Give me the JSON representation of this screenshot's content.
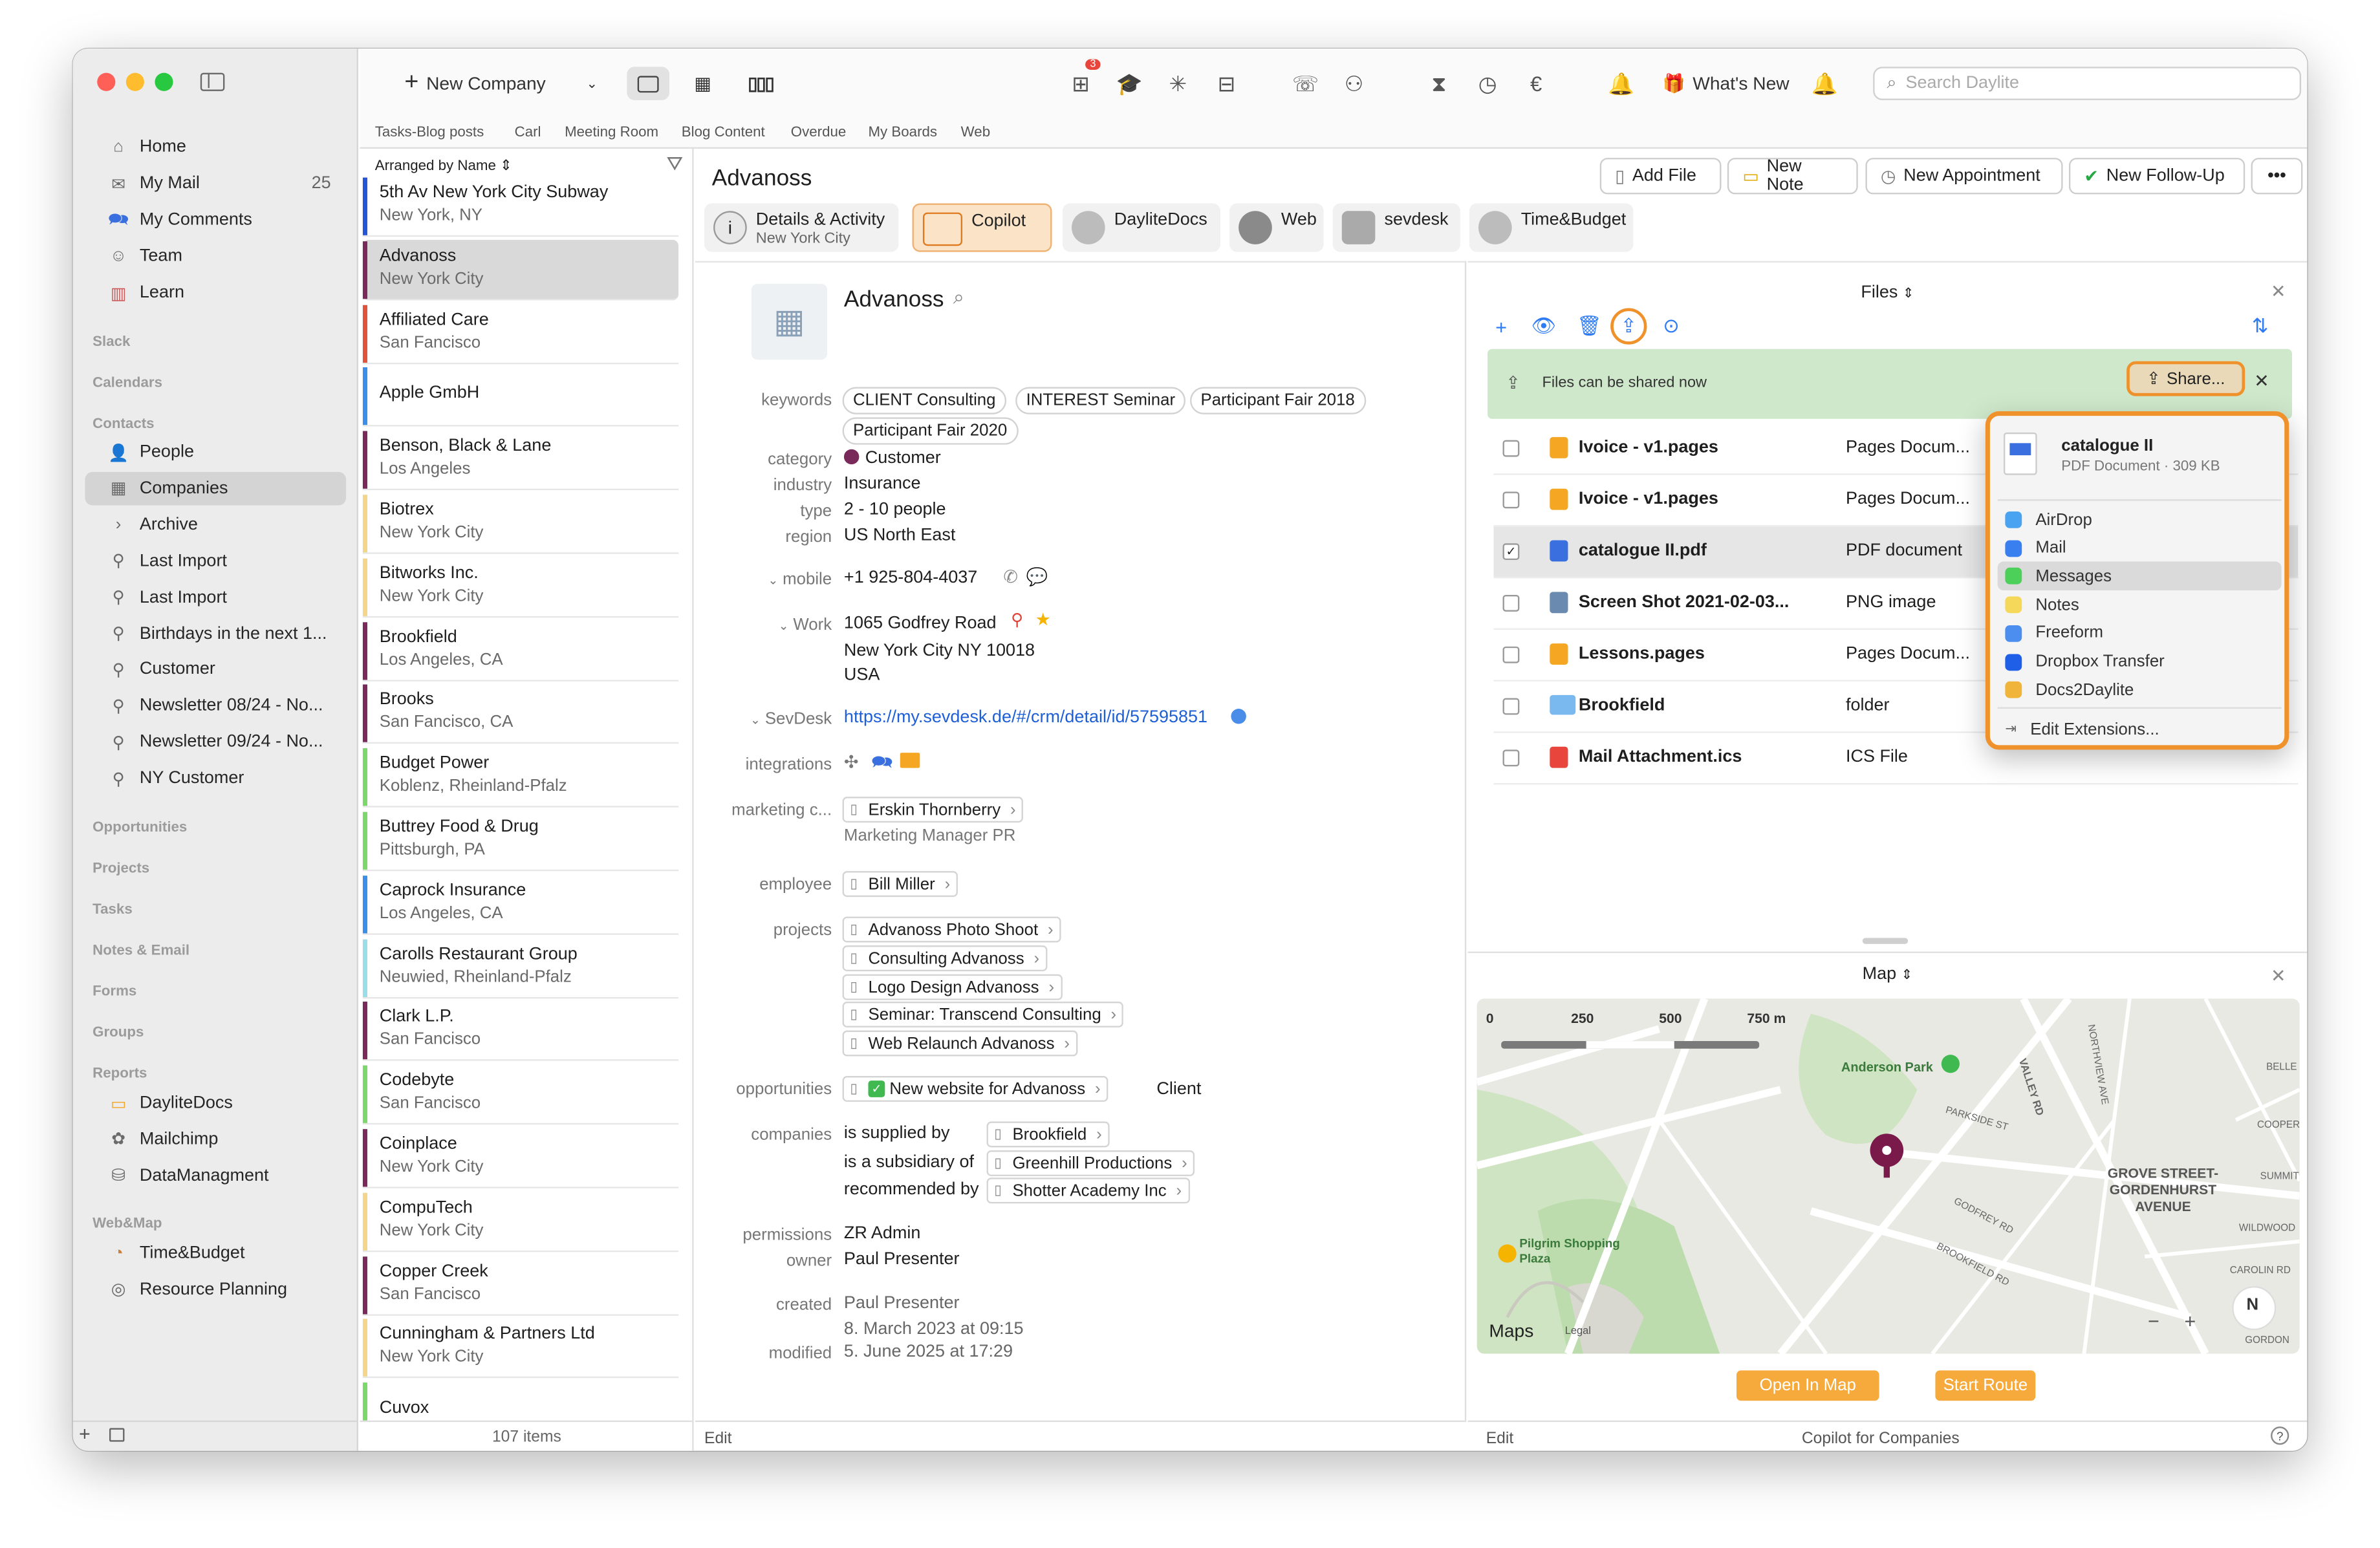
{
  "sidebar": {
    "nav": [
      {
        "label": "Home",
        "icon": "house-icon"
      },
      {
        "label": "My Mail",
        "icon": "envelope-icon",
        "count": "25"
      },
      {
        "label": "My Comments",
        "icon": "comments-icon"
      },
      {
        "label": "Team",
        "icon": "team-icon"
      },
      {
        "label": "Learn",
        "icon": "books-icon"
      }
    ],
    "sections": [
      "Slack",
      "Calendars",
      "Contacts",
      "Opportunities",
      "Projects",
      "Tasks",
      "Notes & Email",
      "Forms",
      "Groups",
      "Reports",
      "Web&Map"
    ],
    "contacts": [
      {
        "label": "People",
        "icon": "person-icon"
      },
      {
        "label": "Companies",
        "icon": "building-icon",
        "selected": true
      },
      {
        "label": "Archive",
        "icon": "chevron-right-icon"
      },
      {
        "label": "Last Import",
        "icon": "smart-list-icon"
      },
      {
        "label": "Last Import",
        "icon": "smart-list-icon"
      },
      {
        "label": "Birthdays in the next 1...",
        "icon": "smart-list-icon"
      },
      {
        "label": "Customer",
        "icon": "smart-list-icon"
      },
      {
        "label": "Newsletter 08/24 - No...",
        "icon": "smart-list-icon"
      },
      {
        "label": "Newsletter 09/24 - No...",
        "icon": "smart-list-icon"
      },
      {
        "label": "NY Customer",
        "icon": "smart-list-icon"
      }
    ],
    "reports": [
      {
        "label": "DayliteDocs",
        "icon": "folder-icon"
      },
      {
        "label": "Mailchimp",
        "icon": "mailchimp-icon"
      },
      {
        "label": "DataManagment",
        "icon": "data-icon"
      }
    ],
    "webmap": [
      {
        "label": "Time&Budget",
        "icon": "timebudget-icon"
      },
      {
        "label": "Resource Planning",
        "icon": "resource-icon"
      }
    ]
  },
  "toolbar": {
    "new_company": "New Company",
    "notification_badge": "3",
    "whats_new": "What's New",
    "search_placeholder": "Search Daylite"
  },
  "favorites": [
    "Tasks-Blog posts",
    "Carl",
    "Meeting Room",
    "Blog Content",
    "Overdue",
    "My Boards",
    "Web"
  ],
  "list": {
    "arranged_by": "Arranged by Name",
    "count": "107 items",
    "companies": [
      {
        "name": "5th Av New York City Subway",
        "city": "New York, NY",
        "color": "#2455d6"
      },
      {
        "name": "Advanoss",
        "city": "New York City",
        "color": "#7a2a5a",
        "selected": true
      },
      {
        "name": "Affiliated Care",
        "city": "San Fancisco",
        "color": "#e0533c"
      },
      {
        "name": "Apple GmbH",
        "city": "",
        "color": "#3d8ee6"
      },
      {
        "name": "Benson, Black & Lane",
        "city": "Los Angeles",
        "color": "#7a2a5a"
      },
      {
        "name": "Biotrex",
        "city": "New York City",
        "color": "#f3d68a"
      },
      {
        "name": "Bitworks Inc.",
        "city": "New York City",
        "color": "#f3d68a"
      },
      {
        "name": "Brookfield",
        "city": "Los Angeles, CA",
        "color": "#7a2a5a"
      },
      {
        "name": "Brooks",
        "city": "San Fancisco, CA",
        "color": "#7a2a5a"
      },
      {
        "name": "Budget Power",
        "city": "Koblenz, Rheinland-Pfalz",
        "color": "#7bd86a"
      },
      {
        "name": "Buttrey Food & Drug",
        "city": "Pittsburgh, PA",
        "color": "#7bd86a"
      },
      {
        "name": "Caprock Insurance",
        "city": "Los Angeles, CA",
        "color": "#3d8ee6"
      },
      {
        "name": "Carolls Restaurant Group",
        "city": "Neuwied, Rheinland-Pfalz",
        "color": "#9bdde8"
      },
      {
        "name": "Clark L.P.",
        "city": "San Fancisco",
        "color": "#7a2a5a"
      },
      {
        "name": "Codebyte",
        "city": "San Fancisco",
        "color": "#7bd86a"
      },
      {
        "name": "Coinplace",
        "city": "New York City",
        "color": "#7a2a5a"
      },
      {
        "name": "CompuTech",
        "city": "New York City",
        "color": "#f3d68a"
      },
      {
        "name": "Copper Creek",
        "city": "San Fancisco",
        "color": "#7a2a5a"
      },
      {
        "name": "Cunningham & Partners Ltd",
        "city": "New York City",
        "color": "#f3d68a"
      },
      {
        "name": "Cuvox",
        "city": "",
        "color": "#7bd86a"
      }
    ]
  },
  "header": {
    "title": "Advanoss",
    "actions": [
      "Add File",
      "New Note",
      "New Appointment",
      "New Follow-Up"
    ],
    "tabs": [
      {
        "label": "Details & Activity",
        "sub": "New York City"
      },
      {
        "label": "Copilot",
        "sub": ""
      },
      {
        "label": "DayliteDocs",
        "sub": ""
      },
      {
        "label": "Web",
        "sub": ""
      },
      {
        "label": "sevdesk",
        "sub": ""
      },
      {
        "label": "Time&Budget",
        "sub": ""
      }
    ]
  },
  "detail": {
    "name": "Advanoss",
    "labels": {
      "keywords": "keywords",
      "category": "category",
      "industry": "industry",
      "type": "type",
      "region": "region",
      "mobile": "mobile",
      "work": "Work",
      "sevdesk": "SevDesk",
      "integrations": "integrations",
      "marketing": "marketing c...",
      "employee": "employee",
      "projects": "projects",
      "opportunities": "opportunities",
      "companies": "companies",
      "permissions": "permissions",
      "owner": "owner",
      "created": "created",
      "modified": "modified"
    },
    "keywords": [
      "CLIENT Consulting",
      "INTEREST Seminar",
      "Participant Fair 2018",
      "Participant Fair 2020"
    ],
    "category": "Customer",
    "category_color": "#7a2a5a",
    "industry": "Insurance",
    "type": "2 - 10 people",
    "region": "US North East",
    "mobile": "+1 925-804-4037",
    "address": [
      "1065 Godfrey Road",
      "New York City NY 10018",
      "USA"
    ],
    "sevdesk_url": "https://my.sevdesk.de/#/crm/detail/id/57595851",
    "marketing_contact": "Erskin Thornberry",
    "marketing_role": "Marketing Manager PR",
    "employee": "Bill Miller",
    "projects": [
      "Advanoss Photo Shoot",
      "Consulting Advanoss",
      "Logo Design Advanoss",
      "Seminar: Transcend Consulting",
      "Web Relaunch Advanoss"
    ],
    "opportunity": "New website for Advanoss",
    "opportunity_role": "Client",
    "relations": [
      {
        "rel": "is supplied by",
        "company": "Brookfield"
      },
      {
        "rel": "is a subsidiary of",
        "company": "Greenhill Productions"
      },
      {
        "rel": "recommended by",
        "company": "Shotter Academy Inc"
      }
    ],
    "permissions": "ZR Admin",
    "owner": "Paul Presenter",
    "created_by": "Paul Presenter",
    "created_at": "8. March 2023 at 09:15",
    "modified": "5. June 2025 at 17:29",
    "edit": "Edit"
  },
  "files": {
    "title": "Files",
    "banner": "Files can be shared now",
    "share_button": "Share...",
    "items": [
      {
        "name": "Ivoice - v1.pages",
        "type": "Pages Docum...",
        "icon": "pages-icon",
        "checked": false
      },
      {
        "name": "Ivoice - v1.pages",
        "type": "Pages Docum...",
        "icon": "pages-icon",
        "checked": false
      },
      {
        "name": "catalogue II.pdf",
        "type": "PDF document",
        "icon": "pdf-icon",
        "checked": true
      },
      {
        "name": "Screen Shot 2021-02-03...",
        "type": "PNG image",
        "icon": "image-icon",
        "checked": false
      },
      {
        "name": "Lessons.pages",
        "type": "Pages Docum...",
        "icon": "pages-icon",
        "checked": false
      },
      {
        "name": "Brookfield",
        "type": "folder",
        "icon": "folder-icon",
        "checked": false
      },
      {
        "name": "Mail Attachment.ics",
        "type": "ICS File",
        "icon": "calendar-icon",
        "checked": false
      }
    ]
  },
  "share_menu": {
    "file_name": "catalogue II",
    "file_info": "PDF Document · 309 KB",
    "items": [
      {
        "label": "AirDrop",
        "color": "#4aa3f0"
      },
      {
        "label": "Mail",
        "color": "#3a7ff0"
      },
      {
        "label": "Messages",
        "color": "#4cd05a",
        "highlighted": true
      },
      {
        "label": "Notes",
        "color": "#f5d85a"
      },
      {
        "label": "Freeform",
        "color": "#4b8ef0"
      },
      {
        "label": "Dropbox Transfer",
        "color": "#1f5fe8"
      },
      {
        "label": "Docs2Daylite",
        "color": "#f0b43a"
      }
    ],
    "edit_extensions": "Edit Extensions..."
  },
  "map": {
    "title": "Map",
    "scale": [
      "0",
      "250",
      "500",
      "750 m"
    ],
    "labels": [
      "Anderson Park",
      "PARKSIDE ST",
      "GODFREY RD",
      "BROOKFIELD RD",
      "VALLEY RD",
      "NORTHVIEW AVE",
      "GROVE STREET-GORDENHURST AVENUE",
      "Pilgrim Shopping Plaza",
      "BELLE",
      "COOPER",
      "SUMMIT",
      "WILDWOOD",
      "CAROLIN RD",
      "GORDON",
      "N"
    ],
    "brand": "Maps",
    "legal": "Legal",
    "open_button": "Open In Map",
    "route_button": "Start Route"
  },
  "footer": {
    "edit": "Edit",
    "copilot": "Copilot for Companies"
  },
  "colors": {
    "accent": "#f0922c",
    "blue": "#2f7bf5",
    "selected": "#d9d9d9"
  }
}
